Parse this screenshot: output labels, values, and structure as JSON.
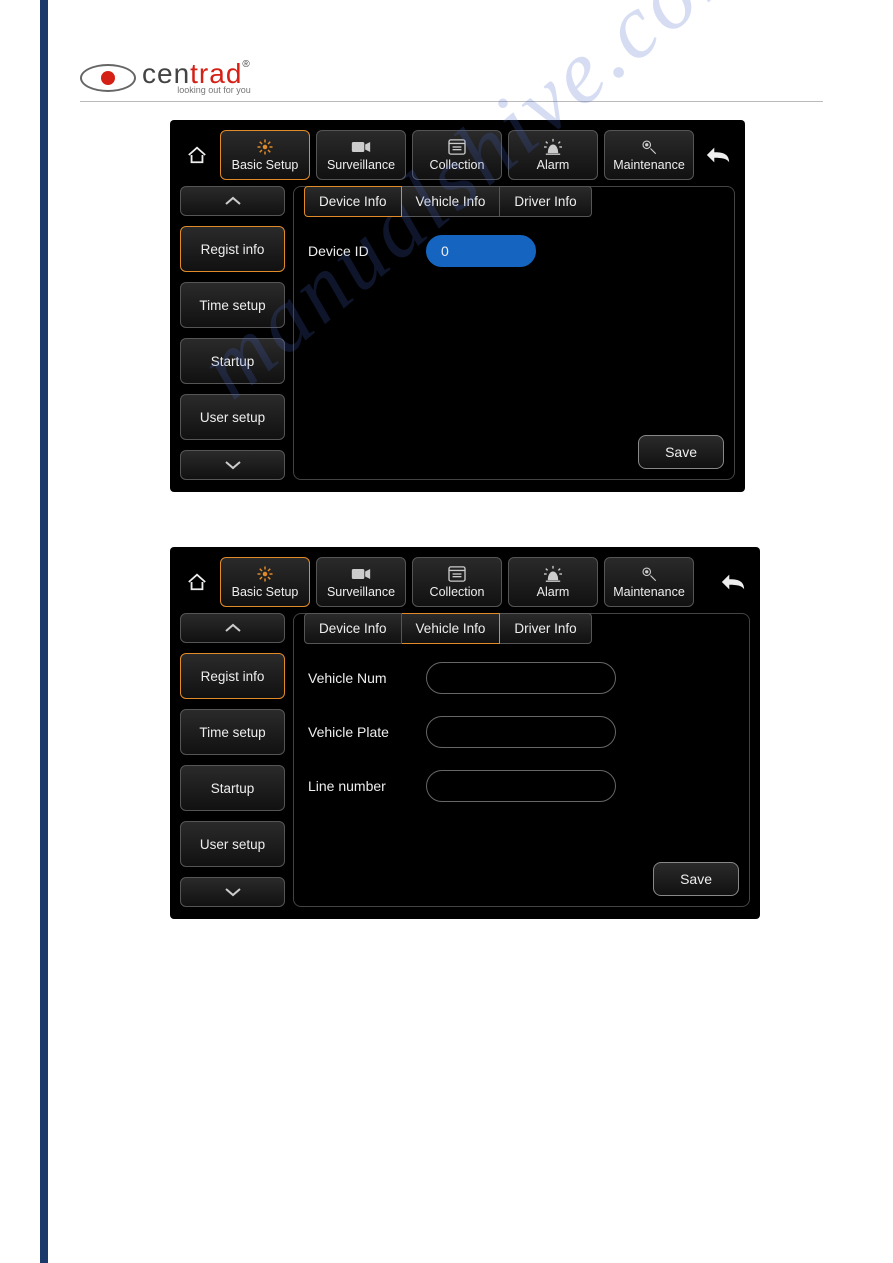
{
  "brand": {
    "name_part1": "cen",
    "name_part2": "trad",
    "reg": "®",
    "tagline": "looking out for you"
  },
  "watermark": "manualshive.com",
  "nav": {
    "basic_setup": "Basic Setup",
    "surveillance": "Surveillance",
    "collection": "Collection",
    "alarm": "Alarm",
    "maintenance": "Maintenance"
  },
  "side": {
    "regist_info": "Regist info",
    "time_setup": "Time setup",
    "startup": "Startup",
    "user_setup": "User setup"
  },
  "tabs": {
    "device_info": "Device Info",
    "vehicle_info": "Vehicle Info",
    "driver_info": "Driver Info"
  },
  "screen1": {
    "device_id_label": "Device ID",
    "device_id_value": "0",
    "save": "Save"
  },
  "screen2": {
    "vehicle_num_label": "Vehicle Num",
    "vehicle_num_value": "",
    "vehicle_plate_label": "Vehicle Plate",
    "vehicle_plate_value": "",
    "line_number_label": "Line number",
    "line_number_value": "",
    "save": "Save"
  }
}
